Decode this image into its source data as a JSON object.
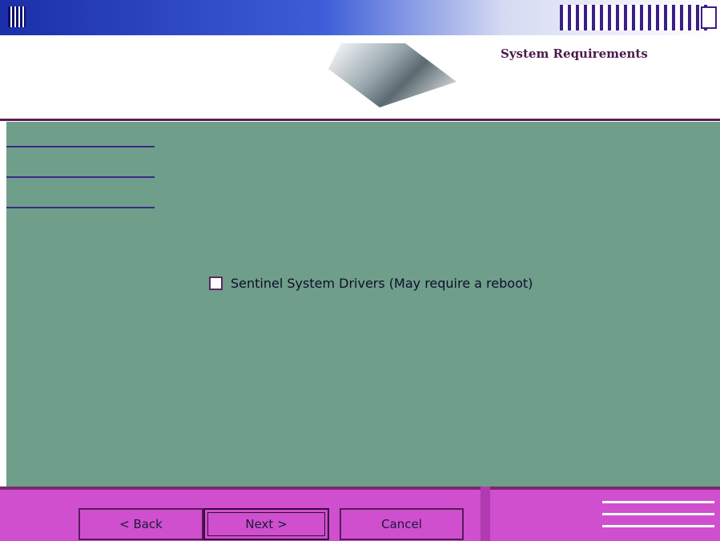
{
  "header": {
    "title": "System Requirements"
  },
  "options": {
    "checkbox_label": "Sentinel System Drivers (May require a reboot)",
    "checked": false
  },
  "buttons": {
    "back": "< Back",
    "next": "Next >",
    "cancel": "Cancel"
  }
}
